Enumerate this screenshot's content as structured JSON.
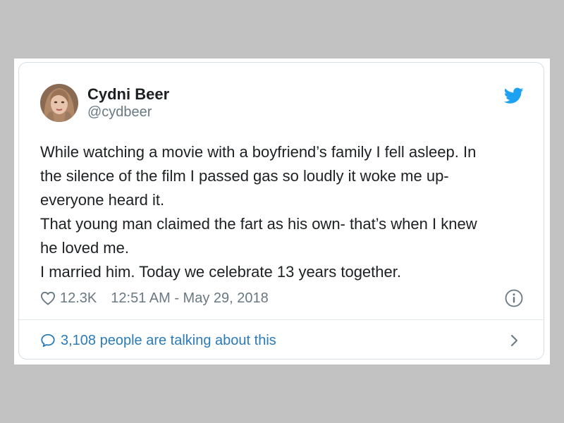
{
  "user": {
    "name": "Cydni Beer",
    "handle": "@cydbeer",
    "avatar_icon": "profile-photo"
  },
  "tweet": {
    "lines": [
      "While watching a movie with a boyfriend’s family I fell asleep. In",
      "the silence of the film I passed gas so loudly it woke me up-",
      "everyone heard it.",
      "That young man claimed the fart as his own- that’s when I knew",
      "he loved me.",
      "I married him. Today we celebrate 13 years together."
    ],
    "likes": "12.3K",
    "timestamp": "12:51 AM - May 29, 2018"
  },
  "footer": {
    "talking_label": "3,108 people are talking about this"
  },
  "icons": {
    "brand": "twitter-bird-icon",
    "like": "heart-icon",
    "info": "info-icon",
    "reply": "speech-bubble-icon",
    "more": "chevron-right-icon"
  },
  "colors": {
    "background": "#c3c2c3",
    "card": "#ffffff",
    "text_primary": "#1c2022",
    "text_secondary": "#697882",
    "link": "#2b7bb9",
    "twitter_blue": "#1da1f2"
  }
}
